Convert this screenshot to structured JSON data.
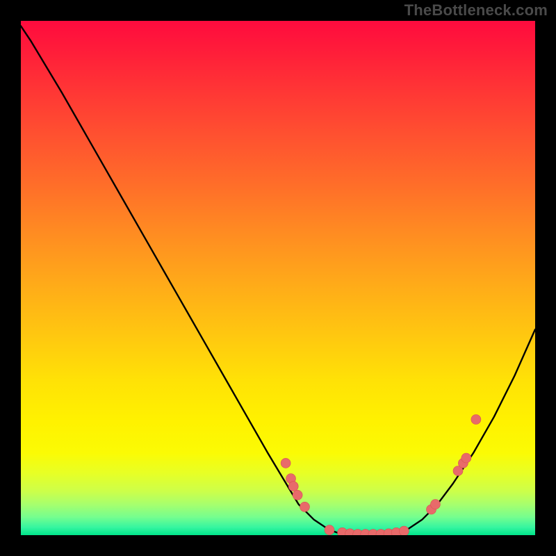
{
  "watermark": "TheBottleneck.com",
  "colors": {
    "page_bg": "#000000",
    "curve": "#000000",
    "point_fill": "#e86a6a",
    "point_stroke": "#d85050",
    "gradient_top": "#ff0b3e",
    "gradient_bottom": "#00e58a"
  },
  "chart_data": {
    "type": "line",
    "title": "",
    "xlabel": "",
    "ylabel": "",
    "xlim": [
      0,
      100
    ],
    "ylim": [
      0,
      100
    ],
    "curve": {
      "x": [
        0,
        2,
        5,
        8,
        12,
        16,
        20,
        24,
        28,
        32,
        36,
        40,
        44,
        48,
        51,
        54,
        57,
        60,
        63,
        66,
        69,
        72,
        75,
        78,
        81,
        84,
        88,
        92,
        96,
        100
      ],
      "y": [
        99,
        96,
        91,
        86,
        79,
        72,
        65,
        58,
        51,
        44,
        37,
        30,
        23,
        16,
        11,
        6,
        3,
        1,
        0,
        0,
        0,
        0,
        1,
        3,
        6,
        10,
        16,
        23,
        31,
        40
      ]
    },
    "points": [
      {
        "x": 51.5,
        "y": 14,
        "label": ""
      },
      {
        "x": 52.5,
        "y": 11,
        "label": ""
      },
      {
        "x": 53.0,
        "y": 9.5,
        "label": ""
      },
      {
        "x": 53.8,
        "y": 7.8,
        "label": ""
      },
      {
        "x": 55.2,
        "y": 5.5,
        "label": ""
      },
      {
        "x": 60.0,
        "y": 1.0,
        "label": ""
      },
      {
        "x": 62.5,
        "y": 0.5,
        "label": ""
      },
      {
        "x": 64.0,
        "y": 0.3,
        "label": ""
      },
      {
        "x": 65.5,
        "y": 0.2,
        "label": ""
      },
      {
        "x": 67.0,
        "y": 0.2,
        "label": ""
      },
      {
        "x": 68.5,
        "y": 0.2,
        "label": ""
      },
      {
        "x": 70.0,
        "y": 0.2,
        "label": ""
      },
      {
        "x": 71.5,
        "y": 0.3,
        "label": ""
      },
      {
        "x": 73.0,
        "y": 0.5,
        "label": ""
      },
      {
        "x": 74.5,
        "y": 0.8,
        "label": ""
      },
      {
        "x": 79.8,
        "y": 5.0,
        "label": ""
      },
      {
        "x": 80.6,
        "y": 6.0,
        "label": ""
      },
      {
        "x": 85.0,
        "y": 12.5,
        "label": ""
      },
      {
        "x": 86.0,
        "y": 14.0,
        "label": ""
      },
      {
        "x": 86.6,
        "y": 15.0,
        "label": ""
      },
      {
        "x": 88.5,
        "y": 22.5,
        "label": ""
      }
    ]
  }
}
